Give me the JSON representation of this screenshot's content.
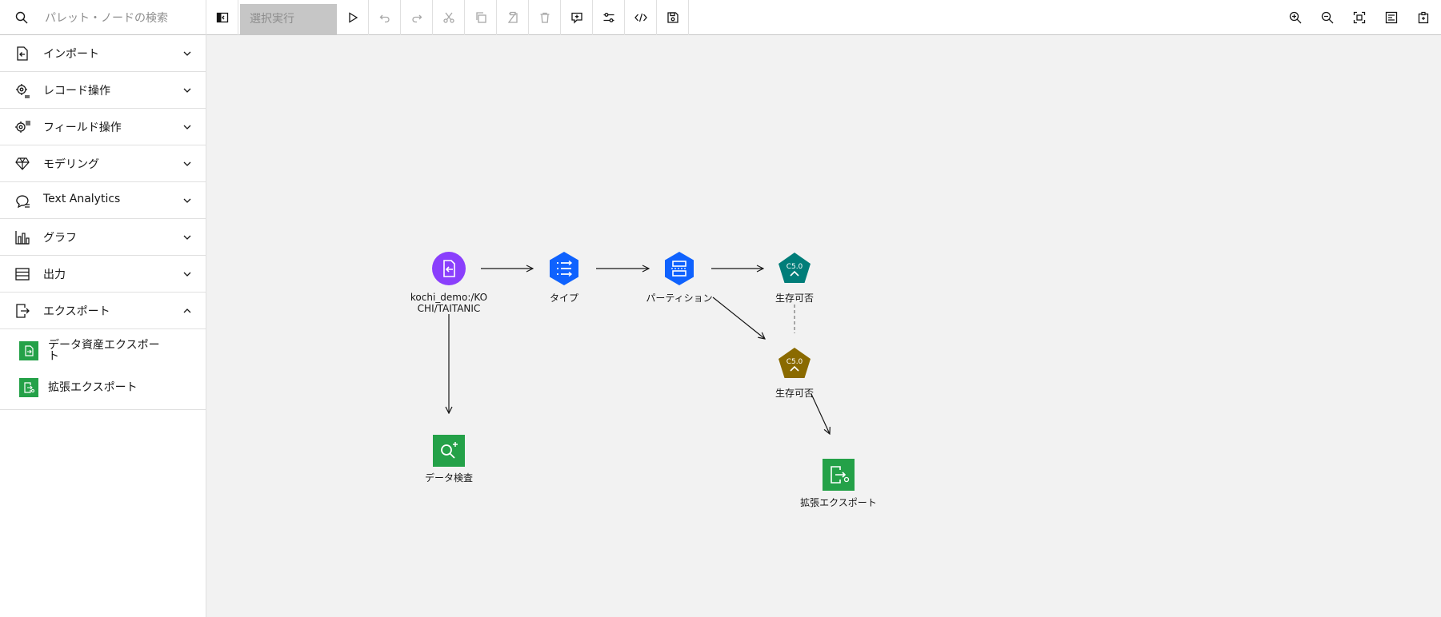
{
  "search": {
    "placeholder": "パレット・ノードの検索"
  },
  "toolbar": {
    "run_selection_label": "選択実行",
    "icons": [
      "palette-toggle-icon",
      "run-icon",
      "undo-icon",
      "redo-icon",
      "cut-icon",
      "copy-icon",
      "paste-icon",
      "delete-icon",
      "comment-icon",
      "settings-icon",
      "code-icon",
      "save-icon"
    ],
    "zoom_icons": [
      "zoom-in-icon",
      "zoom-out-icon",
      "zoom-fit-icon",
      "layout-icon",
      "panel-icon"
    ]
  },
  "palette": {
    "categories": [
      {
        "label": "インポート",
        "icon": "import-icon",
        "expanded": false
      },
      {
        "label": "レコード操作",
        "icon": "record-ops-icon",
        "expanded": false
      },
      {
        "label": "フィールド操作",
        "icon": "field-ops-icon",
        "expanded": false
      },
      {
        "label": "モデリング",
        "icon": "modeling-icon",
        "expanded": false
      },
      {
        "label": "Text Analytics",
        "icon": "text-analytics-icon",
        "expanded": false
      },
      {
        "label": "グラフ",
        "icon": "graph-icon",
        "expanded": false
      },
      {
        "label": "出力",
        "icon": "output-icon",
        "expanded": false
      },
      {
        "label": "エクスポート",
        "icon": "export-icon",
        "expanded": true
      }
    ],
    "export_items": [
      {
        "label": "データ資産エクスポート"
      },
      {
        "label": "拡張エクスポート"
      }
    ]
  },
  "flow": {
    "nodes": [
      {
        "id": "import",
        "label_line1": "kochi_demo:/KO",
        "label_line2": "CHI/TAITANIC",
        "color": "#8a3ffc"
      },
      {
        "id": "type",
        "label": "タイプ",
        "color": "#0f62fe"
      },
      {
        "id": "partition",
        "label": "パーティション",
        "color": "#0f62fe"
      },
      {
        "id": "c50-build",
        "label": "生存可否",
        "badge": "C5.0",
        "color": "#007d79"
      },
      {
        "id": "c50-model",
        "label": "生存可否",
        "badge": "C5.0",
        "color": "#8a6a00"
      },
      {
        "id": "data-audit",
        "label": "データ検査",
        "color": "#24a148"
      },
      {
        "id": "ext-export",
        "label": "拡張エクスポート",
        "color": "#24a148"
      }
    ]
  }
}
